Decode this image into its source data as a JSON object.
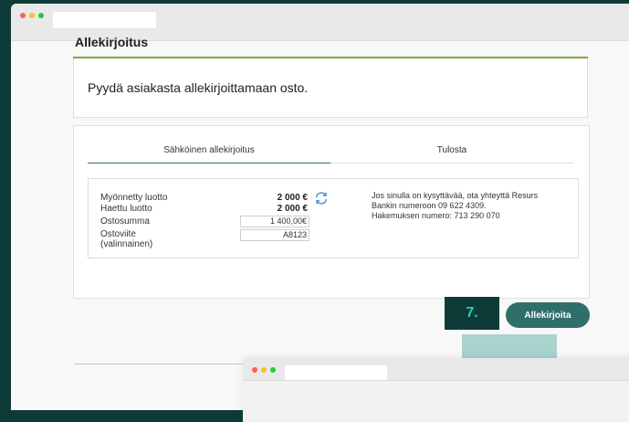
{
  "colors": {
    "backdrop": "#0e3b38",
    "accent_teal": "#2f6f6a",
    "step_text": "#2fcfb3",
    "title_rule_green": "#7ea93e",
    "highlight": "#a9d3cd",
    "dot_red": "#ff5f57",
    "dot_yellow": "#febc2e",
    "dot_green": "#28c840"
  },
  "section": {
    "title": "Allekirjoitus",
    "prompt": "Pyydä asiakasta allekirjoittamaan osto."
  },
  "tabs": [
    {
      "label": "Sähköinen allekirjoitus",
      "active": true
    },
    {
      "label": "Tulosta",
      "active": false
    }
  ],
  "details": {
    "granted_credit_label": "Myönnetty luotto",
    "granted_credit_value": "2 000 €",
    "applied_credit_label": "Haettu luotto",
    "applied_credit_value": "2 000 €",
    "purchase_sum_label": "Ostosumma",
    "purchase_sum_value": "1 400,00€",
    "purchase_ref_label": "Ostoviite",
    "purchase_ref_sublabel": "(valinnainen)",
    "purchase_ref_value": "A8123",
    "refresh_icon": "refresh-icon"
  },
  "contact": {
    "line1": "Jos sinulla on kysyttävää, ota yhteyttä Resurs",
    "line2": "Bankin numeroon 09 622 4309.",
    "line3": "Hakemuksen numero: 713 290 070"
  },
  "step_badge": "7.",
  "sign_button": "Allekirjoita"
}
